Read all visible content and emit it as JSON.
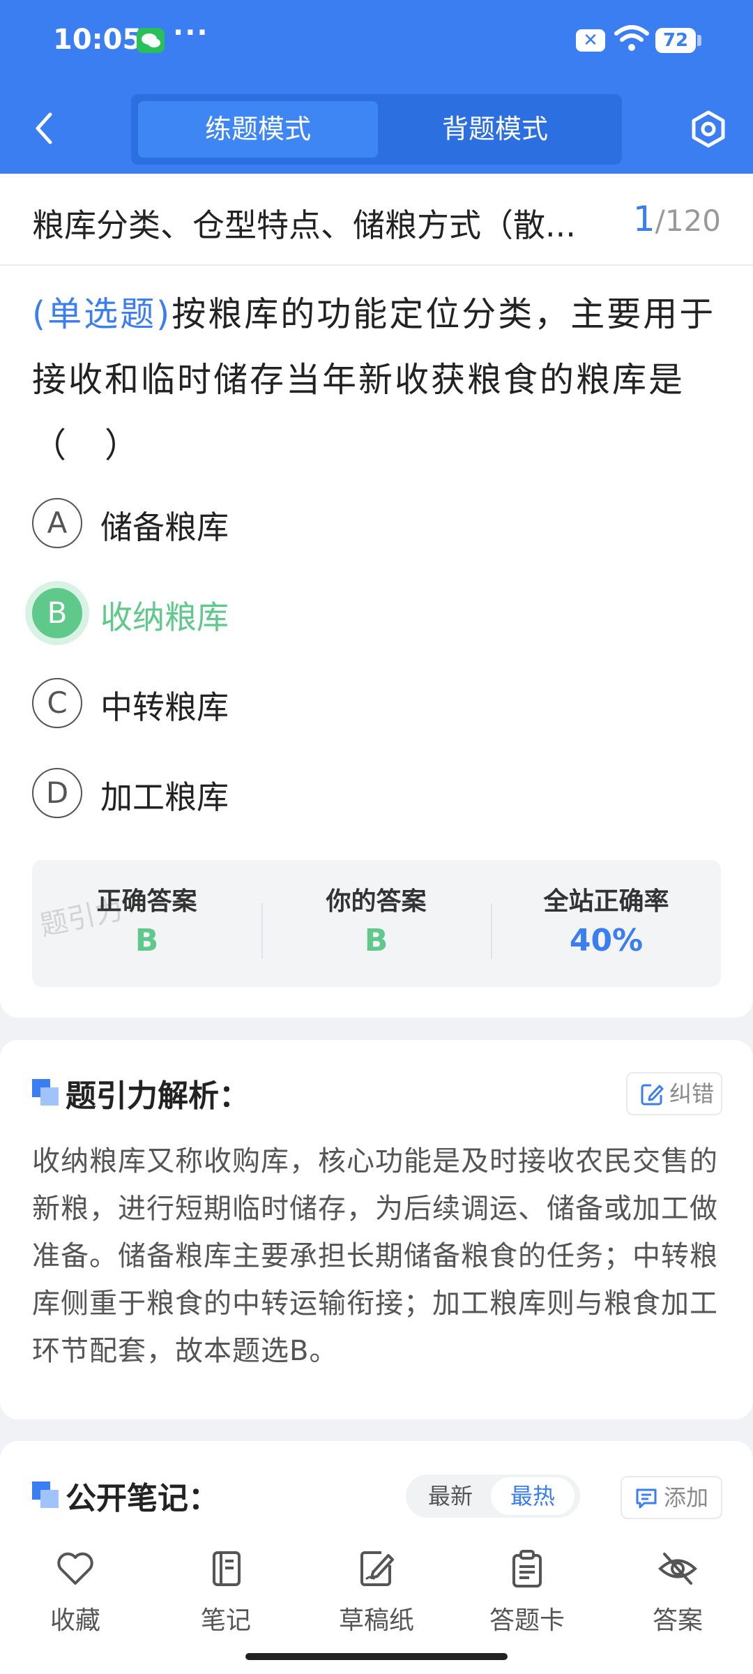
{
  "status_bar": {
    "time": "10:05",
    "dots": "···",
    "sim": "✕",
    "battery": "72"
  },
  "header": {
    "tabs": [
      "练题模式",
      "背题模式"
    ],
    "active_tab": 0
  },
  "breadcrumb": {
    "title": "粮库分类、仓型特点、储粮方式（散...",
    "current": "1",
    "total": "/120"
  },
  "question": {
    "type": "(单选题)",
    "text": "按粮库的功能定位分类，主要用于接收和临时储存当年新收获粮食的粮库是（　）",
    "options": [
      {
        "key": "A",
        "label": "储备粮库"
      },
      {
        "key": "B",
        "label": "收纳粮库",
        "selected": true
      },
      {
        "key": "C",
        "label": "中转粮库"
      },
      {
        "key": "D",
        "label": "加工粮库"
      }
    ]
  },
  "answer_summary": {
    "watermark": "题引力",
    "correct_label": "正确答案",
    "correct_value": "B",
    "yours_label": "你的答案",
    "yours_value": "B",
    "rate_label": "全站正确率",
    "rate_value": "40%"
  },
  "analysis": {
    "title": "题引力解析：",
    "report_label": "纠错",
    "text": "收纳粮库又称收购库，核心功能是及时接收农民交售的新粮，进行短期临时储存，为后续调运、储备或加工做准备。储备粮库主要承担长期储备粮食的任务；中转粮库侧重于粮食的中转运输衔接；加工粮库则与粮食加工环节配套，故本题选B。"
  },
  "notes": {
    "title": "公开笔记：",
    "sort_newest": "最新",
    "sort_hot": "最热",
    "add_label": "添加"
  },
  "bottom_bar": {
    "favorite": "收藏",
    "notes": "笔记",
    "scratch": "草稿纸",
    "answer_card": "答题卡",
    "answer": "答案"
  },
  "colors": {
    "primary": "#3a7ef1",
    "correct": "#5ec98a"
  }
}
